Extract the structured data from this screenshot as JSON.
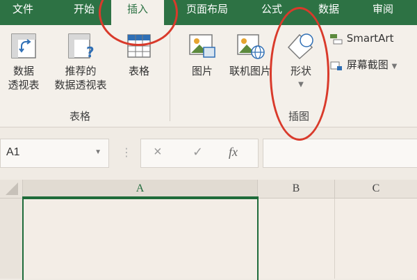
{
  "tabs": [
    {
      "label": "文件"
    },
    {
      "label": "开始"
    },
    {
      "label": "插入"
    },
    {
      "label": "页面布局"
    },
    {
      "label": "公式"
    },
    {
      "label": "数据"
    },
    {
      "label": "审阅"
    }
  ],
  "ribbon": {
    "tables_group": {
      "label": "表格",
      "pivot_line1": "数据",
      "pivot_line2": "透视表",
      "recommended_line1": "推荐的",
      "recommended_line2": "数据透视表",
      "table": "表格"
    },
    "illustrations_group": {
      "label": "插图",
      "picture": "图片",
      "online_picture": "联机图片",
      "shapes": "形状",
      "smartart": "SmartArt",
      "screenshot": "屏幕截图"
    }
  },
  "formula_bar": {
    "name_box": "A1",
    "cancel": "×",
    "enter": "✓",
    "fx": "fx"
  },
  "sheet": {
    "columns": [
      "A",
      "B",
      "C"
    ]
  },
  "colors": {
    "tab_bar": "#2d7244",
    "annotation": "#d93a2b",
    "selection": "#1e6b3a"
  }
}
